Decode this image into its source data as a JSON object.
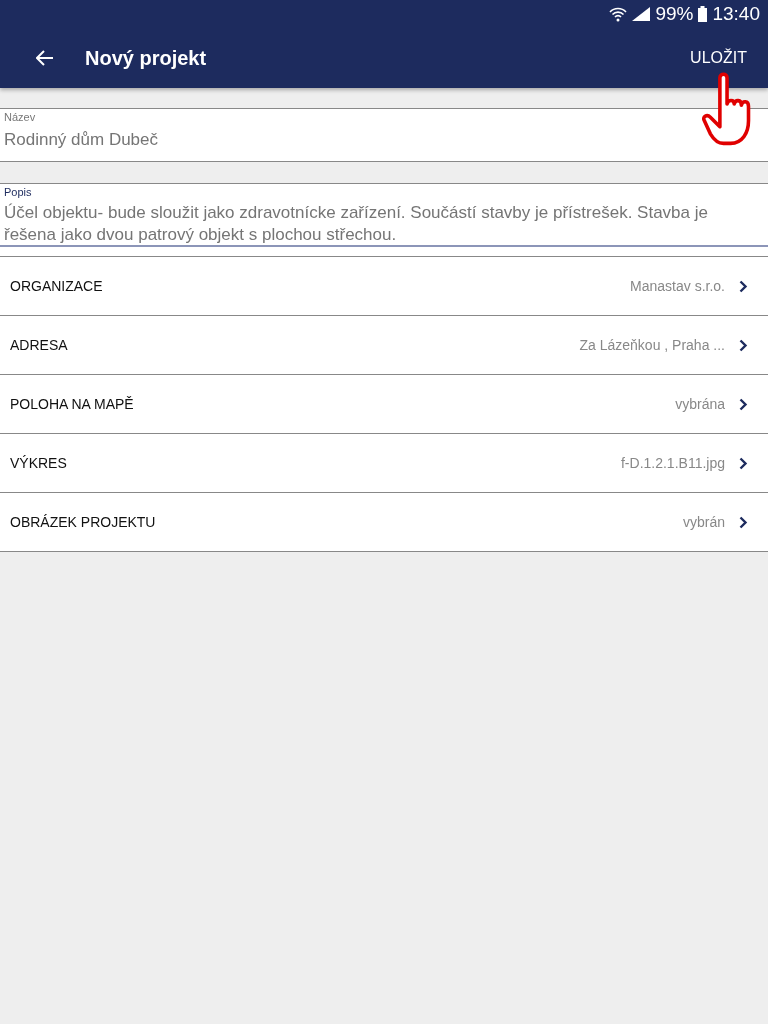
{
  "status_bar": {
    "battery": "99%",
    "time": "13:40"
  },
  "app_bar": {
    "title": "Nový projekt",
    "action": "ULOŽIT"
  },
  "fields": [
    {
      "label": "Název",
      "value": "Rodinný dům Dubeč",
      "focused": false
    },
    {
      "label": "Popis",
      "value": "Účel objektu- bude sloužit jako zdravotnícke zařízení. Součástí stavby je přístrešek. Stavba je řešena jako dvou patrový objekt s plochou střechou.",
      "focused": true
    }
  ],
  "rows": [
    {
      "label": "ORGANIZACE",
      "value": "Manastav s.r.o."
    },
    {
      "label": "ADRESA",
      "value": "Za Lázeňkou , Praha ..."
    },
    {
      "label": "POLOHA NA MAPĚ",
      "value": "vybrána"
    },
    {
      "label": "VÝKRES",
      "value": "f-D.1.2.1.B11.jpg"
    },
    {
      "label": "OBRÁZEK PROJEKTU",
      "value": "vybrán"
    }
  ]
}
